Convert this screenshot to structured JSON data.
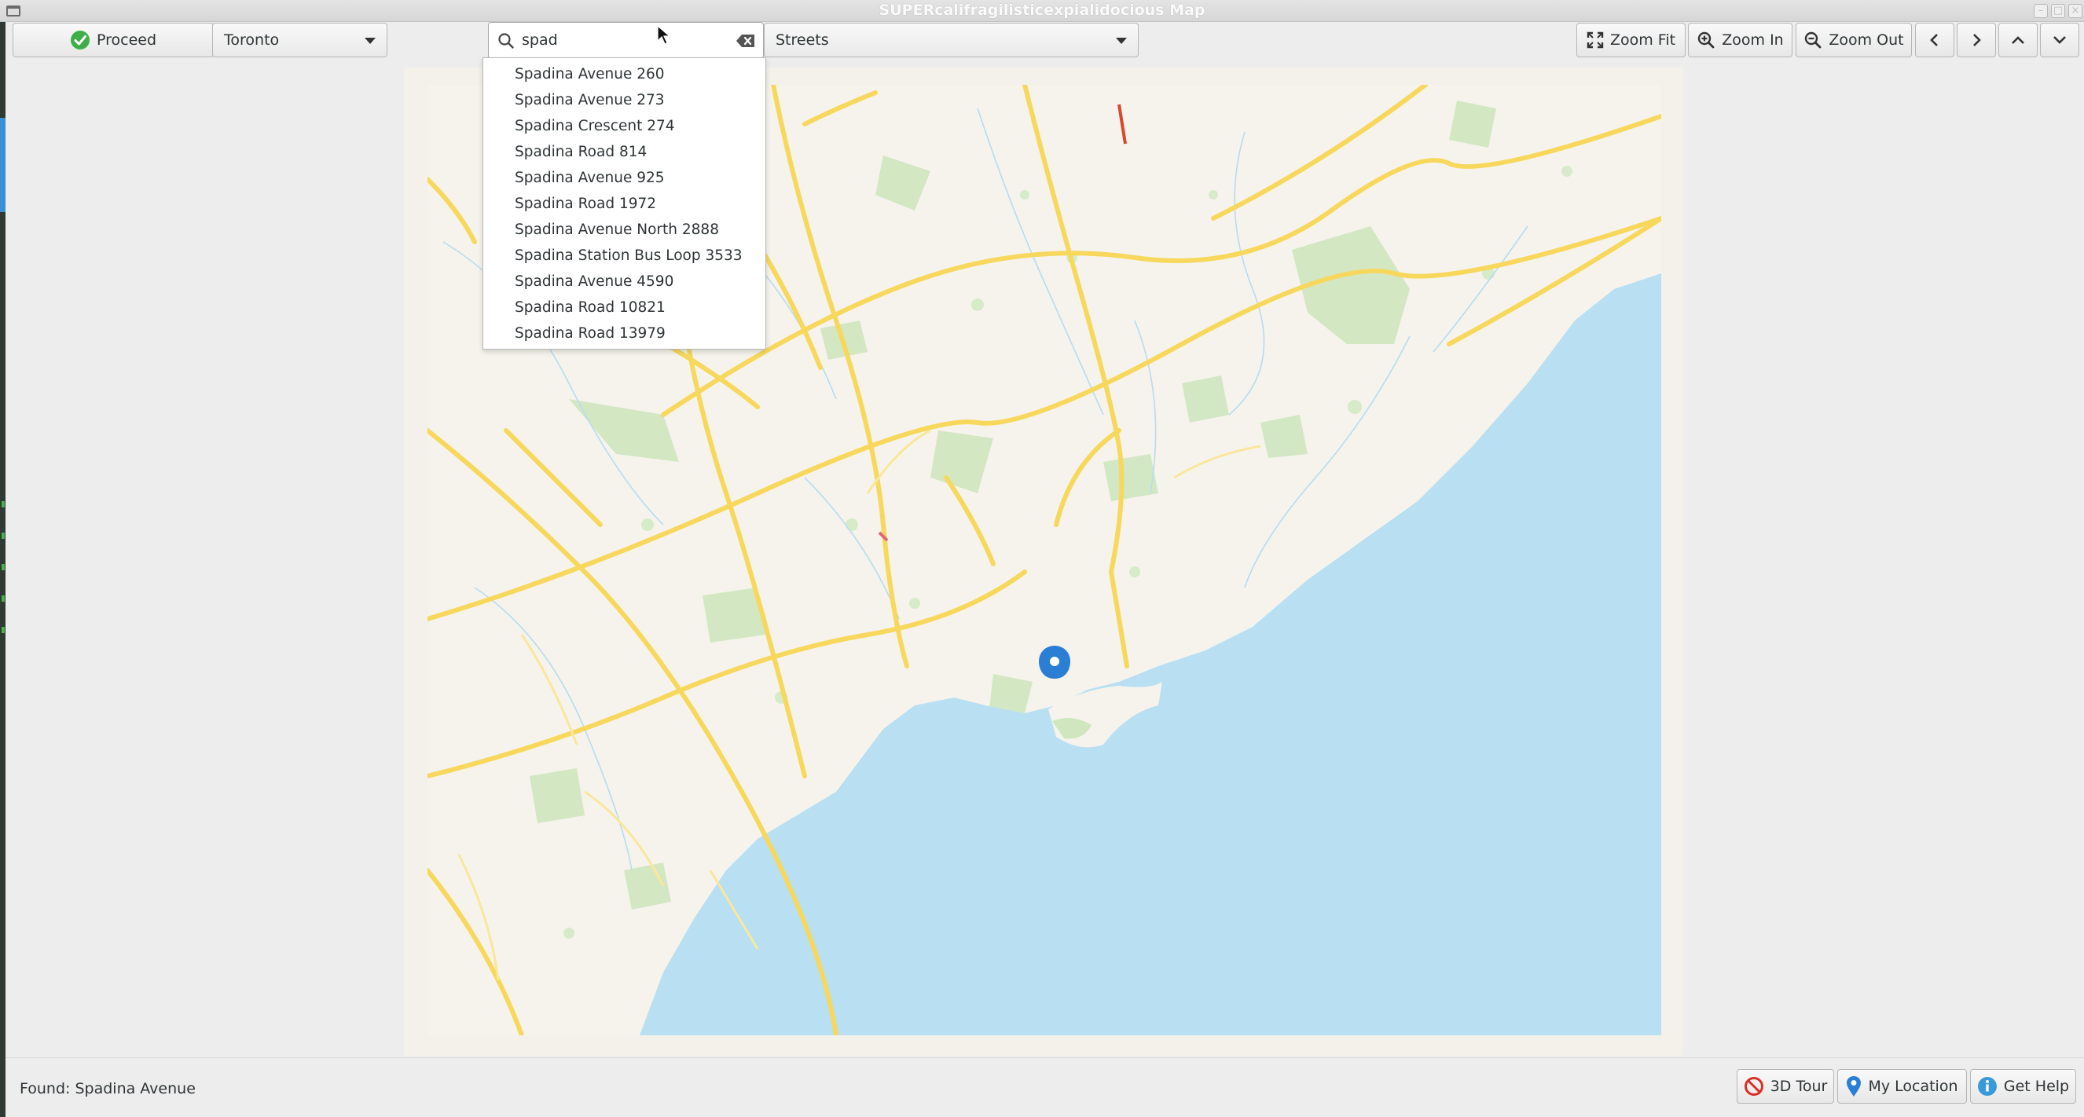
{
  "window": {
    "title": "SUPERcalifragilisticexpialidocious Map",
    "controls": [
      "–",
      "□",
      "×"
    ]
  },
  "toolbar": {
    "proceed_label": "Proceed",
    "city_select": "Toronto",
    "search_value": "spad",
    "layer_select": "Streets",
    "zoom_fit_label": "Zoom Fit",
    "zoom_in_label": "Zoom In",
    "zoom_out_label": "Zoom Out"
  },
  "suggestions": [
    "Spadina Avenue 260",
    "Spadina Avenue 273",
    "Spadina Crescent 274",
    "Spadina Road 814",
    "Spadina Avenue 925",
    "Spadina Road 1972",
    "Spadina Avenue North 2888",
    "Spadina Station Bus Loop 3533",
    "Spadina Avenue 4590",
    "Spadina Road 10821",
    "Spadina Road 13979"
  ],
  "status": {
    "text": "Found: Spadina Avenue"
  },
  "footer": {
    "tour_label": "3D Tour",
    "location_label": "My Location",
    "help_label": "Get Help"
  },
  "colors": {
    "land": "#f3f1ea",
    "water": "#b8dff2",
    "road": "#f7d85c",
    "park": "#cfe7c0",
    "pin": "#2a7fd4",
    "accent_green": "#3fae49",
    "no_symbol_red": "#d93025"
  },
  "icons": {
    "proceed": "check-circle-icon",
    "search": "search-icon",
    "clear": "clear-icon",
    "zoom_fit": "fullscreen-icon",
    "zoom_in": "zoom-in-icon",
    "zoom_out": "zoom-out-icon",
    "pan_left": "chevron-left-icon",
    "pan_right": "chevron-right-icon",
    "pan_up": "chevron-up-icon",
    "pan_down": "chevron-down-icon",
    "tour": "no-entry-icon",
    "location": "map-pin-icon",
    "help": "info-icon"
  }
}
